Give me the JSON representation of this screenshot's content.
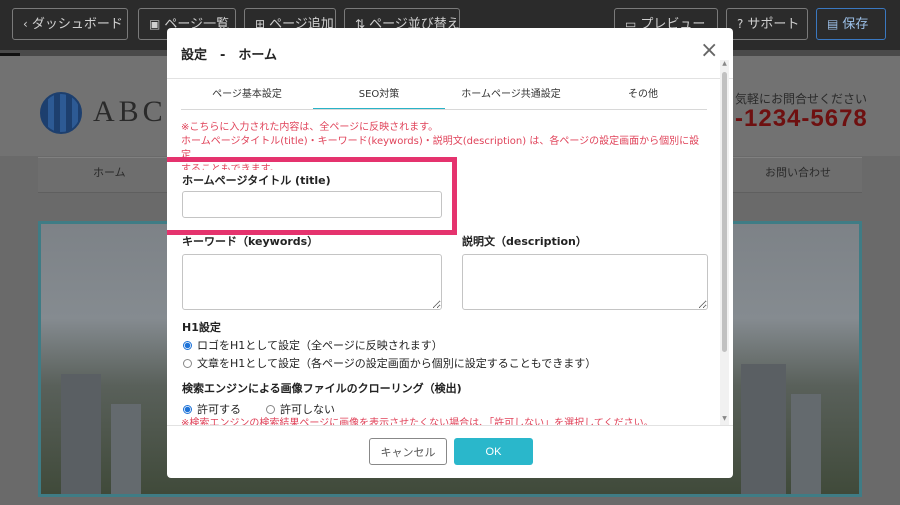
{
  "toolbar": {
    "dashboard": "ダッシュボード",
    "page_list": "ページ一覧",
    "page_add": "ページ追加",
    "page_sort": "ページ並び替え",
    "preview": "プレビュー",
    "support": "サポート",
    "save": "保存"
  },
  "site": {
    "logo": "ABC",
    "contact_lead": "気軽にお問合せください",
    "phone": "-1234-5678",
    "nav": [
      "ホーム",
      "お問い合わせ"
    ]
  },
  "modal": {
    "title": "設定　-　ホーム",
    "close": "×",
    "tabs": [
      "ページ基本設定",
      "SEO対策",
      "ホームページ共通設定",
      "その他"
    ],
    "active_tab": "SEO対策",
    "notice_line1": "※こちらに入力された内容は、全ページに反映されます。",
    "notice_line2": "ホームページタイトル(title)・キーワード(keywords)・説明文(description) は、各ページの設定画面から個別に設定",
    "notice_line3": "することもできます。",
    "title_label": "ホームページタイトル (title)",
    "title_value": "",
    "keywords_label": "キーワード（keywords）",
    "keywords_value": "",
    "description_label": "説明文（description）",
    "description_value": "",
    "h1_label": "H1設定",
    "h1_options": [
      "ロゴをH1として設定（全ページに反映されます）",
      "文章をH1として設定（各ページの設定画面から個別に設定することもできます）"
    ],
    "h1_selected": 0,
    "crawl_label": "検索エンジンによる画像ファイルのクローリング（検出)",
    "crawl_options": [
      "許可する",
      "許可しない"
    ],
    "crawl_selected": 0,
    "crawl_note": "※検索エンジンの検索結果ページに画像を表示させたくない場合は、「許可しない」を選択してください。",
    "cancel": "キャンセル",
    "ok": "OK"
  },
  "colors": {
    "accent": "#2ab7cb",
    "highlight": "#e5336e",
    "notice": "#e0435a"
  }
}
